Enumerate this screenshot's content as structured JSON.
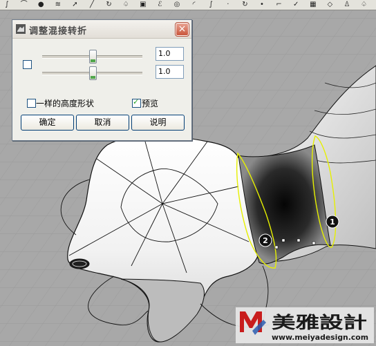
{
  "dialog": {
    "title": "调整混接转折",
    "close_glyph": "×",
    "slider1": {
      "value": 0.5,
      "text": "1.0"
    },
    "slider2": {
      "value": 0.5,
      "text": "1.0"
    },
    "same_height_label": "一样的高度形状",
    "same_height_checked": false,
    "preview_label": "预览",
    "preview_checked": true,
    "lock_checked": false,
    "ok_label": "确定",
    "cancel_label": "取消",
    "help_label": "说明"
  },
  "markers": [
    {
      "label": "1"
    },
    {
      "label": "2"
    }
  ],
  "watermark": {
    "brand_name": "美雅設計",
    "url": "www.meiyadesign.com",
    "accent_color": "#c81d1d"
  },
  "colors": {
    "viewport_bg": "#a8a8a8",
    "grid_line": "#9a9a9a",
    "curve_highlight": "#e6f000"
  },
  "toolbar_icons": [
    "curve-icon",
    "arc-icon",
    "sphere-icon",
    "layers-icon",
    "arrow-icon",
    "line-icon",
    "rotate-icon",
    "lamp-icon",
    "cube-icon",
    "sweep-icon",
    "pipe-icon",
    "fillet-icon",
    "curve-icon",
    "dot-icon",
    "rotate-icon",
    "point-icon",
    "vertex-icon",
    "check-icon",
    "mesh-icon",
    "diamond-icon",
    "person-icon",
    "lamp-icon"
  ]
}
